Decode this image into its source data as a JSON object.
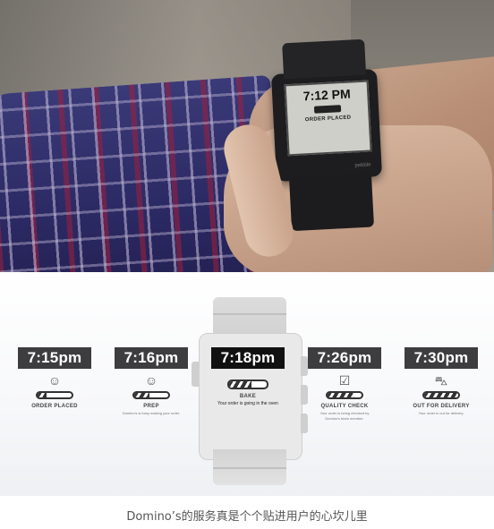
{
  "photo": {
    "watch_time": "7:12 PM",
    "watch_status": "ORDER PLACED",
    "watch_brand": "pebble"
  },
  "timeline": [
    {
      "time": "7:15pm",
      "icon": "pizza-face-icon",
      "label": "ORDER PLACED",
      "sub": "",
      "progress": 0.25
    },
    {
      "time": "7:16pm",
      "icon": "pizza-face-icon",
      "label": "PREP",
      "sub": "Domino's is busy making your order.",
      "progress": 0.45
    },
    {
      "time": "7:18pm",
      "icon": "",
      "label": "BAKE",
      "sub": "Your order is going in the oven",
      "progress": 0.6
    },
    {
      "time": "7:26pm",
      "icon": "checklist-icon",
      "label": "QUALITY CHECK",
      "sub": "Your order is being checked by Domino's team member.",
      "progress": 0.8
    },
    {
      "time": "7:30pm",
      "icon": "delivery-car-icon",
      "label": "OUT FOR DELIVERY",
      "sub": "Your order is out for delivery.",
      "progress": 1.0
    }
  ],
  "caption": "Domino’s的服务真是个个贴进用户的心坎儿里",
  "colors": {
    "time_bg": "#3d3d3f",
    "active_time_bg": "#111111"
  }
}
